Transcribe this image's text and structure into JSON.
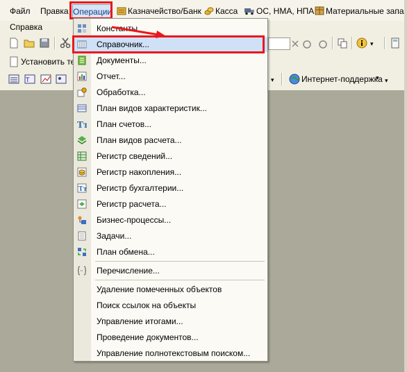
{
  "menubar": {
    "items": [
      {
        "label": "Файл",
        "underline": "Ф"
      },
      {
        "label": "Правка"
      },
      {
        "label": "Операции"
      },
      {
        "label": "Казначейство/Банк",
        "icon": "bank-icon"
      },
      {
        "label": "Касса",
        "icon": "coins-icon"
      },
      {
        "label": "ОС, НМА, НПА",
        "icon": "truck-icon"
      },
      {
        "label": "Материальные запасы",
        "icon": "box-icon"
      }
    ],
    "help": "Справка"
  },
  "toolbar": {
    "set_label": "Установить те",
    "internet_support": "Интернет-поддержка"
  },
  "menu": {
    "items": [
      {
        "label": "Константы",
        "icon": "constants-icon"
      },
      {
        "label": "Справочник...",
        "icon": "catalog-icon",
        "selected": true
      },
      {
        "label": "Документы...",
        "icon": "documents-icon"
      },
      {
        "label": "Отчет...",
        "icon": "report-icon"
      },
      {
        "label": "Обработка...",
        "icon": "processing-icon"
      },
      {
        "label": "План видов характеристик...",
        "icon": "characteristics-icon"
      },
      {
        "label": "План счетов...",
        "icon": "accounts-icon"
      },
      {
        "label": "План видов расчета...",
        "icon": "calc-types-icon"
      },
      {
        "label": "Регистр сведений...",
        "icon": "info-register-icon"
      },
      {
        "label": "Регистр накопления...",
        "icon": "accumulation-register-icon"
      },
      {
        "label": "Регистр бухгалтерии...",
        "icon": "accounting-register-icon"
      },
      {
        "label": "Регистр расчета...",
        "icon": "calc-register-icon"
      },
      {
        "label": "Бизнес-процессы...",
        "icon": "business-process-icon"
      },
      {
        "label": "Задачи...",
        "icon": "tasks-icon"
      },
      {
        "label": "План обмена...",
        "icon": "exchange-plan-icon"
      },
      {
        "label": "Перечисление...",
        "icon": "enumeration-icon"
      },
      {
        "label": "Удаление помеченных объектов"
      },
      {
        "label": "Поиск ссылок на объекты"
      },
      {
        "label": "Управление итогами..."
      },
      {
        "label": "Проведение документов..."
      },
      {
        "label": "Управление полнотекстовым поиском..."
      }
    ]
  },
  "colors": {
    "highlight": "#e8181c",
    "selection": "#cfe0f7",
    "workspace": "#aba999"
  }
}
